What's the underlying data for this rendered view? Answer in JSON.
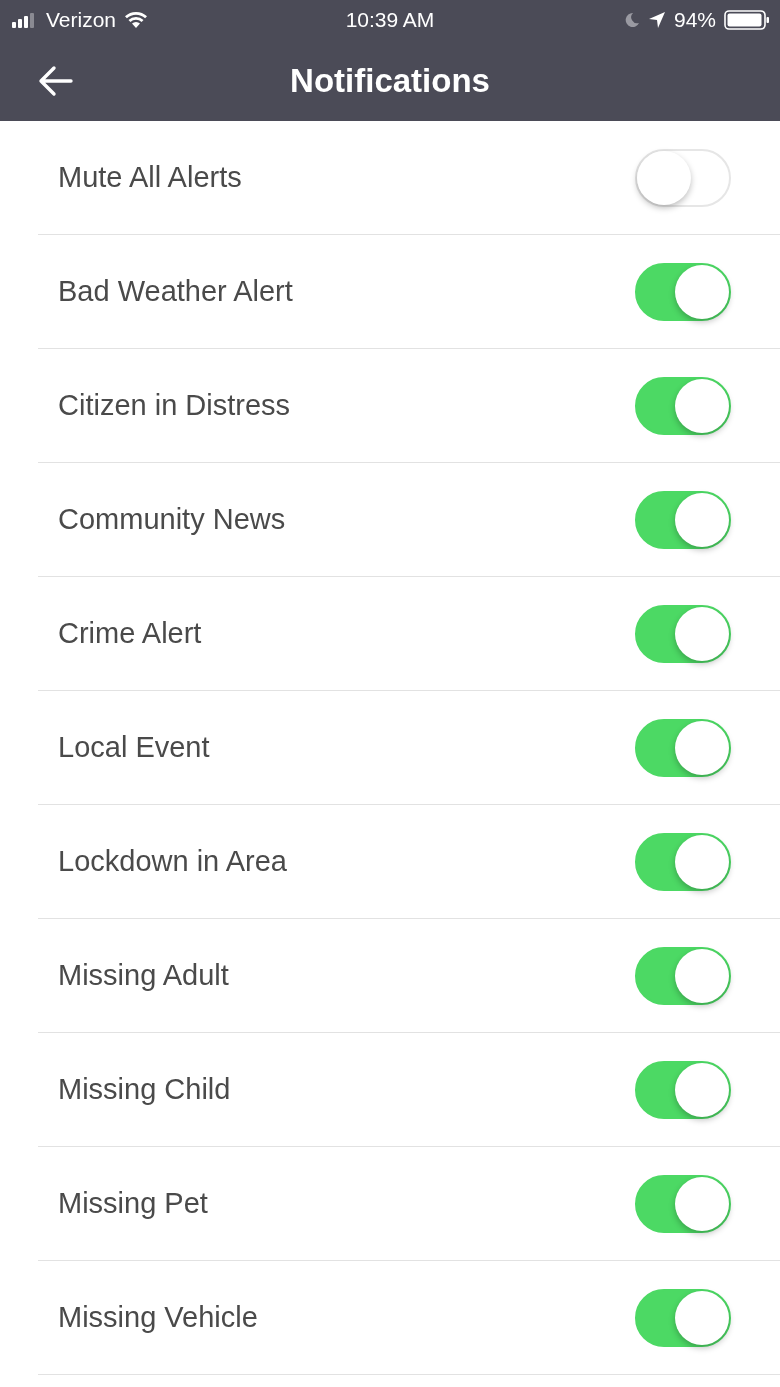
{
  "status_bar": {
    "carrier": "Verizon",
    "time": "10:39 AM",
    "battery": "94%"
  },
  "header": {
    "title": "Notifications"
  },
  "settings": [
    {
      "label": "Mute All Alerts",
      "on": false
    },
    {
      "label": "Bad Weather Alert",
      "on": true
    },
    {
      "label": "Citizen in Distress",
      "on": true
    },
    {
      "label": "Community News",
      "on": true
    },
    {
      "label": "Crime Alert",
      "on": true
    },
    {
      "label": "Local Event",
      "on": true
    },
    {
      "label": "Lockdown in Area",
      "on": true
    },
    {
      "label": "Missing Adult",
      "on": true
    },
    {
      "label": "Missing Child",
      "on": true
    },
    {
      "label": "Missing Pet",
      "on": true
    },
    {
      "label": "Missing Vehicle",
      "on": true
    }
  ]
}
